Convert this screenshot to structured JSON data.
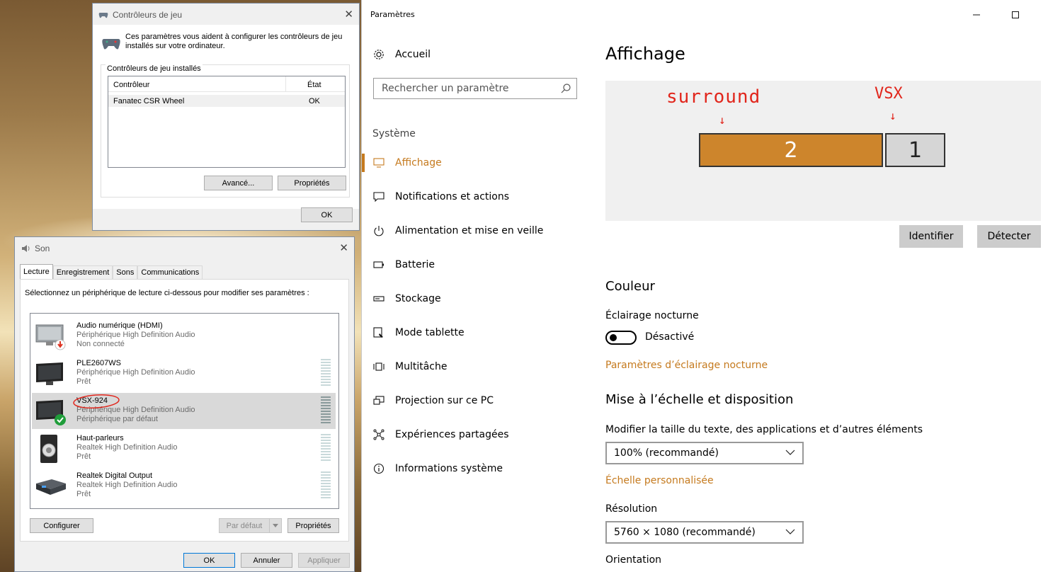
{
  "settings": {
    "window_title": "Paramètres",
    "home": "Accueil",
    "search_placeholder": "Rechercher un paramètre",
    "section": "Système",
    "nav": [
      "Affichage",
      "Notifications et actions",
      "Alimentation et mise en veille",
      "Batterie",
      "Stockage",
      "Mode tablette",
      "Multitâche",
      "Projection sur ce PC",
      "Expériences partagées",
      "Informations système"
    ],
    "nav_icons": [
      "monitor-icon",
      "notification-icon",
      "power-icon",
      "battery-icon",
      "storage-icon",
      "tablet-icon",
      "multitask-icon",
      "projection-icon",
      "shared-icon",
      "info-icon"
    ],
    "title": "Affichage",
    "monitors": {
      "left_label": "2",
      "right_label": "1"
    },
    "annotations": {
      "left": "surround",
      "right": "VSX"
    },
    "identify": "Identifier",
    "detect": "Détecter",
    "color_heading": "Couleur",
    "night_light_label": "Éclairage nocturne",
    "night_light_state": "Désactivé",
    "night_light_link": "Paramètres d’éclairage nocturne",
    "scale_heading": "Mise à l’échelle et disposition",
    "scale_label": "Modifier la taille du texte, des applications et d’autres éléments",
    "scale_value": "100% (recommandé)",
    "custom_scale_link": "Échelle personnalisée",
    "resolution_label": "Résolution",
    "resolution_value": "5760 × 1080 (recommandé)",
    "orientation_label": "Orientation",
    "accent_color": "#c57a1e"
  },
  "game": {
    "title": "Contrôleurs de jeu",
    "desc": "Ces paramètres vous aident à configurer les contrôleurs de jeu installés sur votre ordinateur.",
    "group": "Contrôleurs de jeu installés",
    "col_controller": "Contrôleur",
    "col_state": "État",
    "row_name": "Fanatec CSR Wheel",
    "row_state": "OK",
    "advanced": "Avancé...",
    "properties": "Propriétés",
    "ok": "OK"
  },
  "son": {
    "title": "Son",
    "tabs": [
      "Lecture",
      "Enregistrement",
      "Sons",
      "Communications"
    ],
    "instruction": "Sélectionnez un périphérique de lecture ci-dessous pour modifier ses paramètres :",
    "devices": [
      {
        "name": "Audio numérique (HDMI)",
        "desc": "Périphérique High Definition Audio",
        "status": "Non connecté"
      },
      {
        "name": "PLE2607WS",
        "desc": "Périphérique High Definition Audio",
        "status": "Prêt"
      },
      {
        "name": "VSX-924",
        "desc": "Périphérique High Definition Audio",
        "status": "Périphérique par défaut"
      },
      {
        "name": "Haut-parleurs",
        "desc": "Realtek High Definition Audio",
        "status": "Prêt"
      },
      {
        "name": "Realtek Digital Output",
        "desc": "Realtek High Definition Audio",
        "status": "Prêt"
      }
    ],
    "configure": "Configurer",
    "default": "Par défaut",
    "properties": "Propriétés",
    "ok": "OK",
    "cancel": "Annuler",
    "apply": "Appliquer"
  }
}
